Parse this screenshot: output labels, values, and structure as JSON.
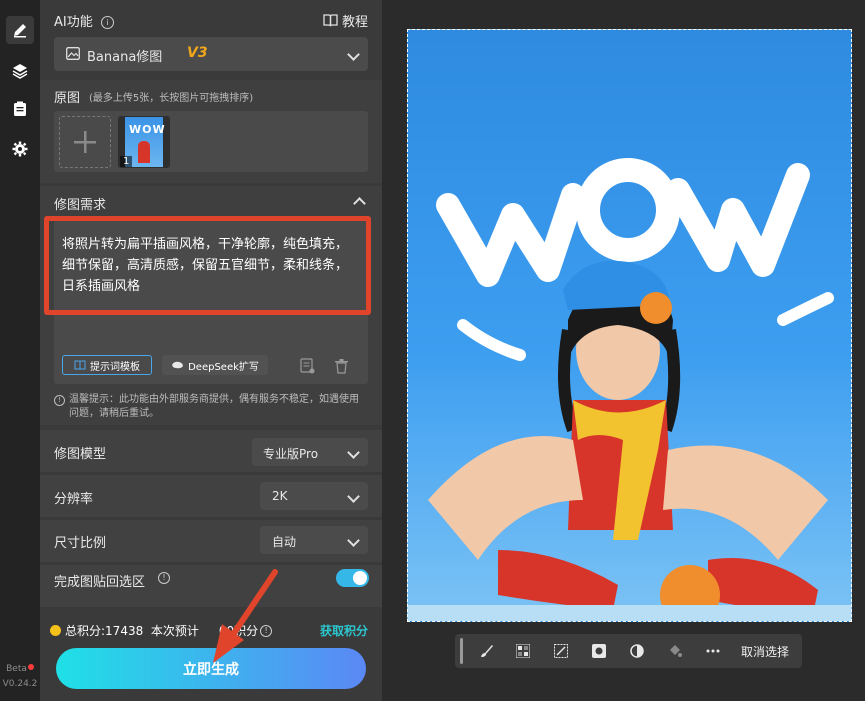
{
  "ai_feature": {
    "title": "AI功能",
    "tutorial_label": "教程"
  },
  "mode_select": {
    "name": "Banana修图",
    "version": "V3"
  },
  "original": {
    "title": "原图",
    "hint": "(最多上传5张，长按图片可拖拽排序)",
    "thumb_index": "1",
    "thumb_text": "WOW"
  },
  "edit_request": {
    "title": "修图需求",
    "prompt": "将照片转为扁平插画风格，干净轮廓，纯色填充，细节保留，高清质感，保留五官细节，柔和线条，日系插画风格",
    "template_button": "提示词模板",
    "deepseek_button": "DeepSeek扩写"
  },
  "notice": "温馨提示：此功能由外部服务商提供，偶有服务不稳定，如遇使用问题，请稍后重试。",
  "settings": {
    "model": {
      "label": "修图模型",
      "value": "专业版Pro"
    },
    "resolution": {
      "label": "分辨率",
      "value": "2K"
    },
    "ratio": {
      "label": "尺寸比例",
      "value": "自动"
    },
    "paste_back": {
      "label": "完成图贴回选区",
      "enabled": true
    }
  },
  "footer": {
    "points_text": "总积分:17438  本次预计",
    "points_tail": "00积分",
    "get_points": "获取积分",
    "generate_button": "立即生成"
  },
  "rail": {
    "beta": "Beta",
    "version": "V0.24.2"
  },
  "canvas": {
    "image_text": "WOW"
  },
  "toolbar": {
    "cancel_selection": "取消选择"
  },
  "colors": {
    "accent": "#35b8e8",
    "highlight_box": "#e0452b",
    "generate_gradient_start": "#1fe0e6",
    "generate_gradient_end": "#5b88f5",
    "arrow": "#e0452b",
    "coin": "#f4c21b"
  }
}
